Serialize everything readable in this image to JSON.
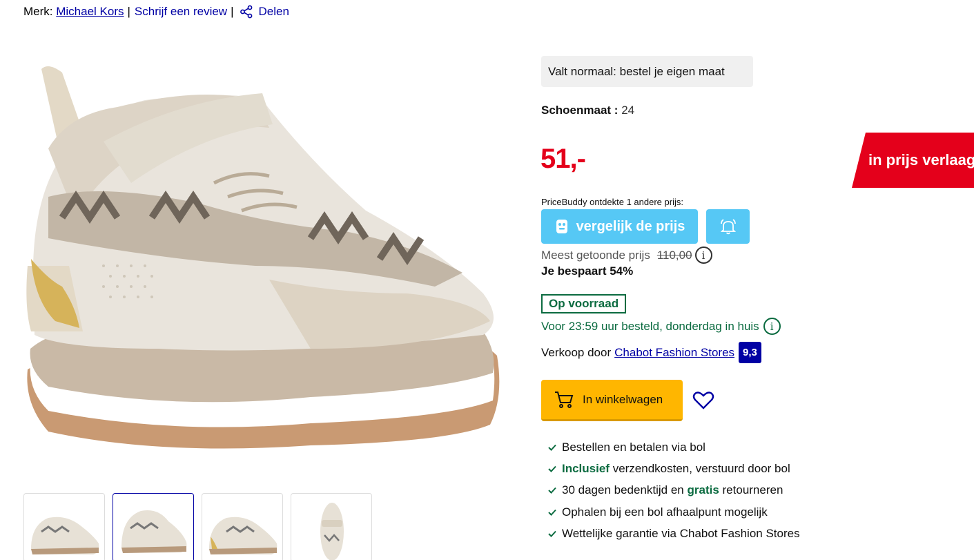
{
  "meta": {
    "brand_label": "Merk:",
    "brand_name": "Michael Kors",
    "review_link": "Schrijf een review",
    "share_label": "Delen"
  },
  "fit_note": "Valt normaal: bestel je eigen maat",
  "size": {
    "label": "Schoenmaat :",
    "value": "24"
  },
  "price": "51,-",
  "promo_badge": "in prijs verlaagd",
  "pricebuddy": {
    "text": "PriceBuddy ontdekte 1 andere prijs:",
    "compare_label": "vergelijk de prijs"
  },
  "most_shown": {
    "label": "Meest getoonde prijs",
    "value": "110,00"
  },
  "savings": "Je bespaart 54%",
  "stock": "Op voorraad",
  "delivery": "Voor 23:59 uur besteld, donderdag in huis",
  "seller": {
    "label": "Verkoop door",
    "name": "Chabot Fashion Stores",
    "rating": "9,3"
  },
  "cart_label": "In winkelwagen",
  "usps": {
    "u1": "Bestellen en betalen via bol",
    "u2_bold": "Inclusief",
    "u2_rest": " verzendkosten, verstuurd door bol",
    "u3_a": "30 dagen bedenktijd en ",
    "u3_bold": "gratis",
    "u3_b": " retourneren",
    "u4": "Ophalen bij een bol afhaalpunt mogelijk",
    "u5": "Wettelijke garantie via Chabot Fashion Stores"
  },
  "colors": {
    "price_red": "#e4001b",
    "link_blue": "#0000a4",
    "stock_green": "#0b6b40",
    "cart_yellow": "#ffb600",
    "pricebuddy_blue": "#56c8f5"
  }
}
